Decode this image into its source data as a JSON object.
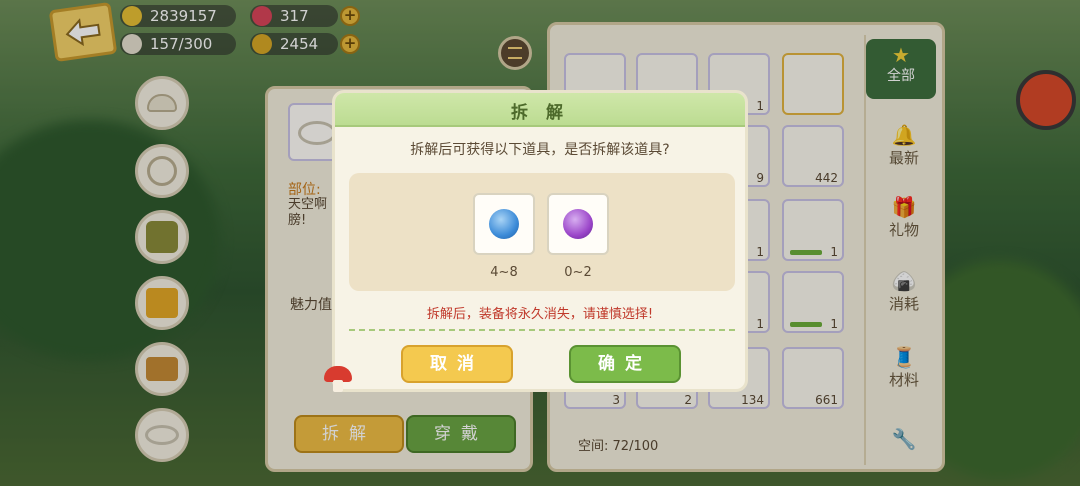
{
  "resources": {
    "gold": "2839157",
    "gem": "317",
    "stamina": "157/300",
    "coin": "2454"
  },
  "left_slots": [
    "hat-icon",
    "earmuff-icon",
    "jacket-icon",
    "skirt-icon",
    "boots-icon",
    "wings-icon"
  ],
  "detail_panel": {
    "part_label": "部位:",
    "desc_text": "天空啊 膀!",
    "charm_label": "魅力值",
    "split_button": "拆解",
    "wear_button": "穿戴"
  },
  "inventory": {
    "space_label": "空间:",
    "space_value": "72/100",
    "cells": [
      {
        "count": ""
      },
      {
        "count": ""
      },
      {
        "count": "1"
      },
      {
        "count": ""
      },
      {
        "count": "9"
      },
      {
        "count": "442"
      },
      {
        "count": "1"
      },
      {
        "count": "1"
      },
      {
        "count": "1"
      },
      {
        "count": "1"
      },
      {
        "count": "3"
      },
      {
        "count": "2"
      },
      {
        "count": "134"
      },
      {
        "count": "661"
      }
    ],
    "categories": [
      "全部",
      "最新",
      "礼物",
      "消耗",
      "材料"
    ]
  },
  "modal": {
    "title": "拆 解",
    "question": "拆解后可获得以下道具，是否拆解该道具?",
    "rewards": [
      {
        "name": "blue-gem",
        "range": "4~8",
        "color": "#3c8bd8"
      },
      {
        "name": "purple-gem",
        "range": "0~2",
        "color": "#9b46c9"
      }
    ],
    "warning": "拆解后，装备将永久消失，请谨慎选择!",
    "cancel_label": "取消",
    "confirm_label": "确定"
  },
  "colors": {
    "accent_green": "#7cbb4a",
    "accent_yellow": "#f4c94f",
    "warning_red": "#c0392b"
  }
}
